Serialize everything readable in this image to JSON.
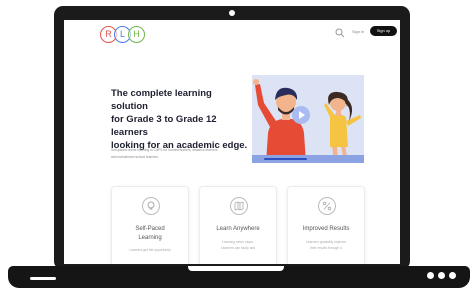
{
  "header": {
    "logo_letters": [
      "R",
      "L",
      "H"
    ],
    "logo_colors": [
      "#e3554c",
      "#4b7be0",
      "#6fb54a"
    ],
    "sign_in": "Sign in",
    "sign_up": "Sign up"
  },
  "hero": {
    "title_lines": [
      "The complete learning solution",
      "for Grade 3 to Grade 12 learners",
      "looking for an academic edge."
    ],
    "subtitle_lines": [
      "Self-paced online learning in CAPS for homeschoolers, distance learners",
      "and mainstream school learners."
    ],
    "video_progress": 0.45
  },
  "cards": [
    {
      "icon": "lightbulb-icon",
      "title_lines": [
        "Self-Paced",
        "Learning"
      ],
      "text_lines": [
        "Learners get the opportunity"
      ]
    },
    {
      "icon": "map-icon",
      "title_lines": [
        "Learn Anywhere"
      ],
      "text_lines": [
        "Learning never stops.",
        "Learners can study and"
      ]
    },
    {
      "icon": "percent-icon",
      "title_lines": [
        "Improved Results"
      ],
      "text_lines": [
        "Learners gradually improve",
        "their results through a"
      ]
    }
  ],
  "colors": {
    "frame": "#1b1b1b",
    "signup_bg": "#111111",
    "video_bg": "#dce3f5",
    "video_bar": "#8ba3e3",
    "boy_shirt": "#e64b35",
    "girl_shirt": "#f6c443"
  }
}
